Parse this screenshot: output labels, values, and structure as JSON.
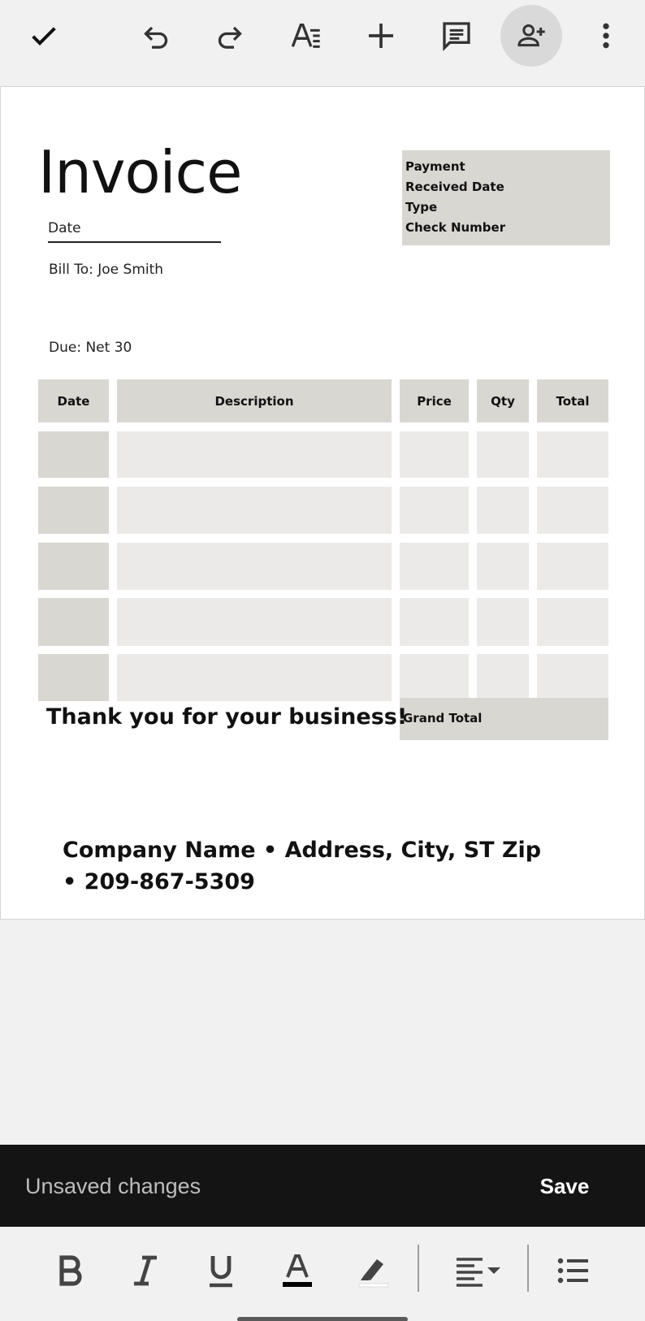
{
  "toolbar": {
    "icons": [
      "check-icon",
      "undo-icon",
      "redo-icon",
      "text-format-icon",
      "insert-plus-icon",
      "comment-icon",
      "share-person-add-icon",
      "more-vert-icon"
    ]
  },
  "document": {
    "title": "Invoice",
    "date_label": "Date",
    "bill_to": "Bill To: Joe Smith",
    "due": "Due: Net 30",
    "payment_box": {
      "lines": [
        "Payment",
        "Received Date",
        "Type",
        "Check Number"
      ]
    },
    "table": {
      "headers": [
        "Date",
        "Description",
        "Price",
        "Qty",
        "Total"
      ],
      "row_count": 5
    },
    "grand_total_label": "Grand Total",
    "thank_you": "Thank you for your business!",
    "company_line": "Company Name • Address, City, ST Zip • 209-867-5309"
  },
  "snackbar": {
    "message": "Unsaved changes",
    "action": "Save"
  },
  "format_bar": {
    "icons": [
      "bold-icon",
      "italic-icon",
      "underline-icon",
      "text-color-icon",
      "highlight-icon",
      "align-icon",
      "bulleted-list-icon"
    ],
    "text_color": "#000000",
    "highlight_color": "#ffffff"
  },
  "colors": {
    "background": "#f1f1f1",
    "cell_dark": "#d9d7d2",
    "cell_light": "#ebeae8",
    "snackbar": "#141414"
  }
}
